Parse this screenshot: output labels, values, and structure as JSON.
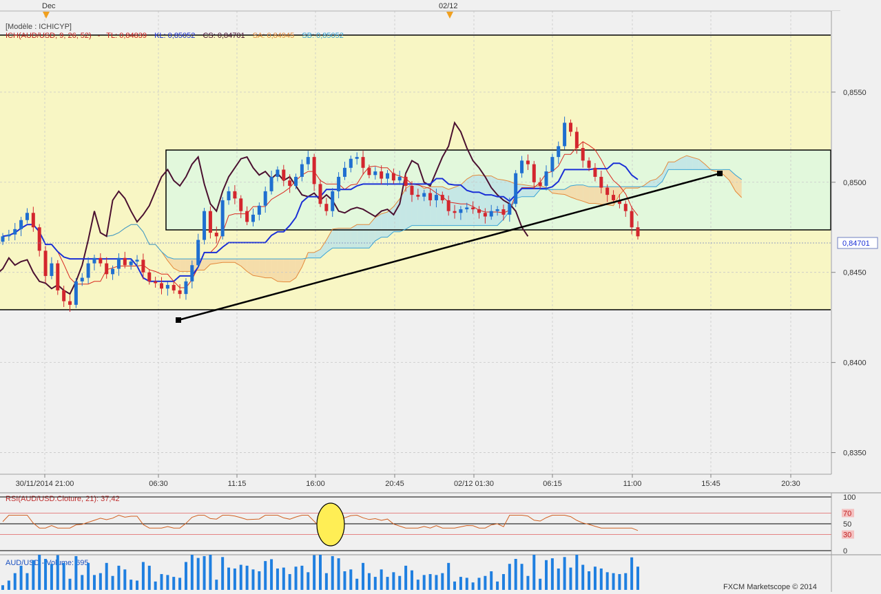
{
  "colors": {
    "background": "#f0f0f0",
    "zone_yellow": "#f8f6c4",
    "zone_green": "#e2f8dc",
    "kumo_orange": "#f4d8a6",
    "kumo_blue": "#bfe4e6",
    "candle_up": "#1f6fd0",
    "candle_down": "#d3262e",
    "tenkan": "#d9281f",
    "kijun": "#1a2fd6",
    "chikou": "#4a1030",
    "ssa": "#e4893a",
    "ssb": "#38a3d6",
    "rsi_line": "#d06020",
    "rsi_level": "#e06060",
    "volume": "#1f7fe0",
    "trendline": "#000000",
    "highlight": "#ffee55"
  },
  "header": {
    "model": "[Modèle : ICHICYP]",
    "ich_name": "ICH(AUD/USD, 9, 26, 52)",
    "tl": "TL: 0,84839",
    "kl": "KL: 0,85052",
    "cs": "CS: 0,84701",
    "sa": "SA: 0,84945",
    "sb": "SB: 0,85052"
  },
  "top_markers": {
    "dec": "Dec",
    "d0212": "02/12"
  },
  "last_price": "0,84701",
  "footer": "FXCM Marketscope © 2014",
  "chart_data": [
    {
      "type": "candlestick",
      "title": "",
      "instrument": "AUD/USD",
      "y_ticks": [
        "0,8550",
        "0,8500",
        "0,8450",
        "0,8400",
        "0,8350"
      ],
      "y_tick_values": [
        0.855,
        0.85,
        0.845,
        0.84,
        0.835
      ],
      "ylim": [
        0.8338,
        0.8595
      ],
      "x_labels": [
        "30/11/2014 21:00",
        "06:30",
        "11:15",
        "16:00",
        "20:45",
        "02/12 01:30",
        "06:15",
        "11:00",
        "15:45",
        "20:30"
      ],
      "last_value": 0.84701,
      "close_path": [
        0.847,
        0.8471,
        0.8474,
        0.8479,
        0.8483,
        0.8475,
        0.8462,
        0.8448,
        0.8455,
        0.844,
        0.8434,
        0.8432,
        0.8445,
        0.8447,
        0.8455,
        0.8458,
        0.8455,
        0.8449,
        0.8452,
        0.8458,
        0.8454,
        0.8456,
        0.8457,
        0.845,
        0.8445,
        0.8444,
        0.8441,
        0.8443,
        0.844,
        0.8438,
        0.8445,
        0.8454,
        0.8468,
        0.8484,
        0.8472,
        0.847,
        0.849,
        0.8495,
        0.8491,
        0.8484,
        0.8478,
        0.8482,
        0.8487,
        0.8495,
        0.8503,
        0.8507,
        0.8501,
        0.8498,
        0.8503,
        0.851,
        0.8514,
        0.8499,
        0.8488,
        0.8484,
        0.8495,
        0.8503,
        0.8508,
        0.8513,
        0.8514,
        0.8508,
        0.8504,
        0.8506,
        0.8502,
        0.8505,
        0.8501,
        0.8503,
        0.8498,
        0.8493,
        0.8492,
        0.8494,
        0.849,
        0.8493,
        0.849,
        0.8484,
        0.8483,
        0.8485,
        0.8486,
        0.8485,
        0.8483,
        0.8481,
        0.8484,
        0.8485,
        0.8482,
        0.8488,
        0.8505,
        0.8512,
        0.851,
        0.85,
        0.8498,
        0.8506,
        0.8514,
        0.852,
        0.8533,
        0.8528,
        0.8519,
        0.8512,
        0.8508,
        0.8503,
        0.8497,
        0.8493,
        0.849,
        0.8488,
        0.8484,
        0.8475,
        0.847
      ]
    },
    {
      "type": "line",
      "title": "RSI(AUD/USD.Cloture, 21): 37,42",
      "y_ticks": [
        "100",
        "70",
        "50",
        "30",
        "0"
      ],
      "levels": [
        100,
        70,
        50,
        30,
        0
      ],
      "last_value": 37.42
    },
    {
      "type": "bar",
      "title": "AUD/USD - Volume: 695",
      "last_value": 695
    }
  ]
}
